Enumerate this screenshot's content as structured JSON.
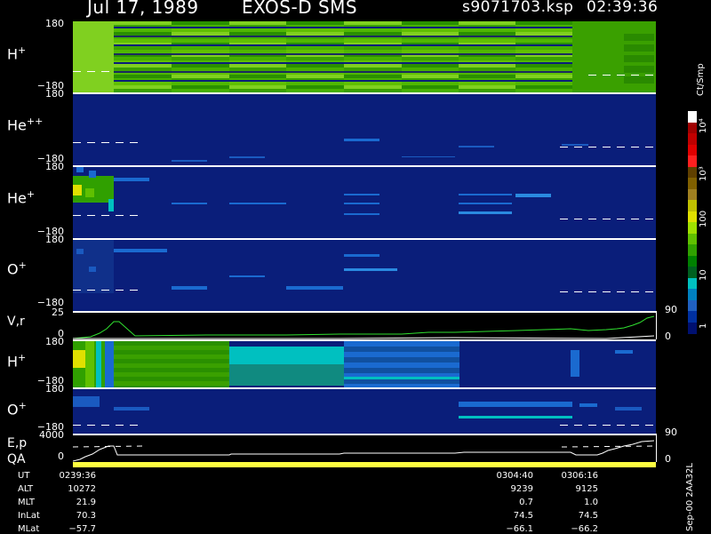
{
  "header": {
    "date": "Jul 17, 1989",
    "instrument": "EXOS-D SMS",
    "file": "s9071703.ksp",
    "time": "02:39:36"
  },
  "colorbar": {
    "unit_label": "Ct/Smp",
    "tick_labels": [
      "10⁴",
      "10³",
      "100",
      "10",
      "1"
    ],
    "colors": [
      "#ffffff",
      "#a00000",
      "#c00000",
      "#e00000",
      "#ff2020",
      "#604000",
      "#806000",
      "#a08020",
      "#c0c000",
      "#e0e000",
      "#a0e000",
      "#60c000",
      "#30a000",
      "#008000",
      "#006020",
      "#00c0c0",
      "#0080c0",
      "#2060c0",
      "#0030a0",
      "#001070"
    ]
  },
  "panels": {
    "h_plus_top": {
      "label": "H",
      "sup": "+",
      "ymax": "180",
      "ymin": "−180"
    },
    "he_pp": {
      "label": "He",
      "sup": "++",
      "ymax": "180",
      "ymin": "−180"
    },
    "he_plus": {
      "label": "He",
      "sup": "+",
      "ymax": "180",
      "ymin": "−180"
    },
    "o_plus_top": {
      "label": "O",
      "sup": "+",
      "ymax": "180",
      "ymin": "−180"
    },
    "vr": {
      "label": "V,r",
      "ymax": "25",
      "ymin": "0",
      "rmax": "90",
      "rmin": "0"
    },
    "h_plus_bot": {
      "label": "H",
      "sup": "+",
      "ymax": "180",
      "ymin": "−180"
    },
    "o_plus_bot": {
      "label": "O",
      "sup": "+",
      "ymax": "180",
      "ymin": "−180"
    },
    "ep": {
      "label": "E,p",
      "ymax": "4000",
      "ymin": "0",
      "rmax": "90",
      "rmin": "0"
    },
    "qa": {
      "label": "QA"
    }
  },
  "ephemeris": {
    "row_labels": [
      "UT",
      "ALT",
      "MLT",
      "InLat",
      "MLat"
    ],
    "columns": [
      {
        "values": [
          "0239:36",
          "10272",
          "21.9",
          "70.3",
          "−57.7"
        ]
      },
      {
        "values": [
          "0304:40",
          "9239",
          "0.7",
          "74.5",
          "−66.1"
        ]
      },
      {
        "values": [
          "0306:16",
          "9125",
          "1.0",
          "74.5",
          "−66.2"
        ]
      }
    ]
  },
  "footer_stamp": "Sep-00 2AA32L",
  "chart_data": {
    "type": "heatmap",
    "title": "Jul 17, 1989   EXOS-D SMS",
    "x_ticks": [
      "0239:36",
      "0304:40",
      "0306:16"
    ],
    "panels": [
      "H+",
      "He++",
      "He+",
      "O+",
      "V,r",
      "H+",
      "O+",
      "E,p",
      "QA"
    ],
    "y_range_pitch": [
      -180,
      180
    ],
    "y_range_vr": [
      0,
      25
    ],
    "y_range_ep": [
      0,
      4000
    ],
    "color_scale": "log",
    "color_range": [
      1,
      10000
    ],
    "color_unit": "Ct/Smp"
  }
}
